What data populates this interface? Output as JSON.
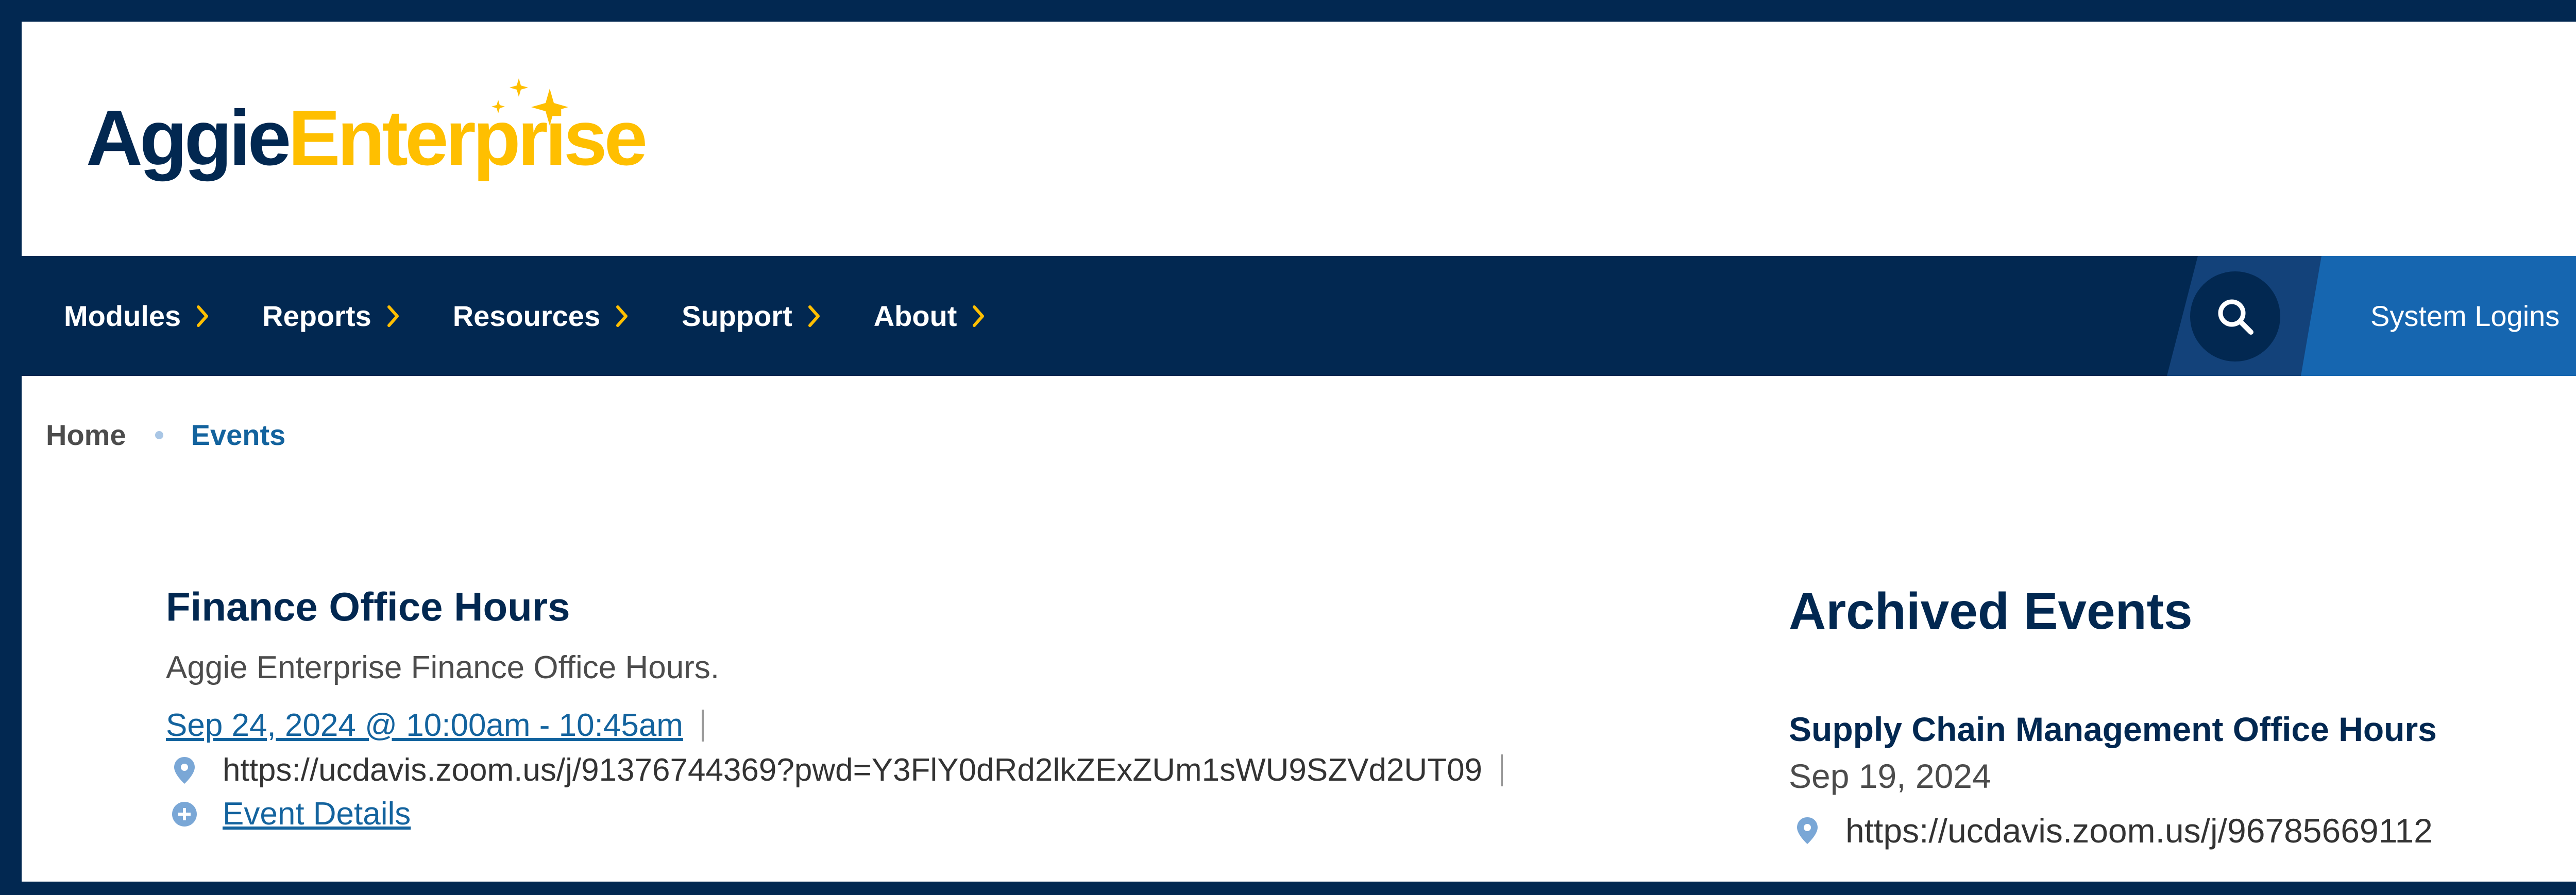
{
  "brand": {
    "logo_part1": "Aggie",
    "logo_part2": "Enterprise",
    "primary_color": "#022851",
    "accent_color": "#FFBF00",
    "link_color": "#13639e"
  },
  "nav": {
    "items": [
      {
        "label": "Modules"
      },
      {
        "label": "Reports"
      },
      {
        "label": "Resources"
      },
      {
        "label": "Support"
      },
      {
        "label": "About"
      }
    ],
    "search_icon": "search-icon",
    "logins_label": "System Logins"
  },
  "breadcrumb": {
    "home": "Home",
    "current": "Events"
  },
  "event": {
    "title": "Finance Office Hours",
    "description": "Aggie Enterprise Finance Office Hours.",
    "datetime": "Sep 24, 2024 @ 10:00am - 10:45am",
    "location": "https://ucdavis.zoom.us/j/91376744369?pwd=Y3FlY0dRd2lkZExZUm1sWU9SZVd2UT09",
    "details_label": "Event Details"
  },
  "sidebar": {
    "title": "Archived Events",
    "events": [
      {
        "title": "Supply Chain Management Office Hours",
        "date": "Sep 19, 2024",
        "location": "https://ucdavis.zoom.us/j/96785669112"
      }
    ]
  }
}
